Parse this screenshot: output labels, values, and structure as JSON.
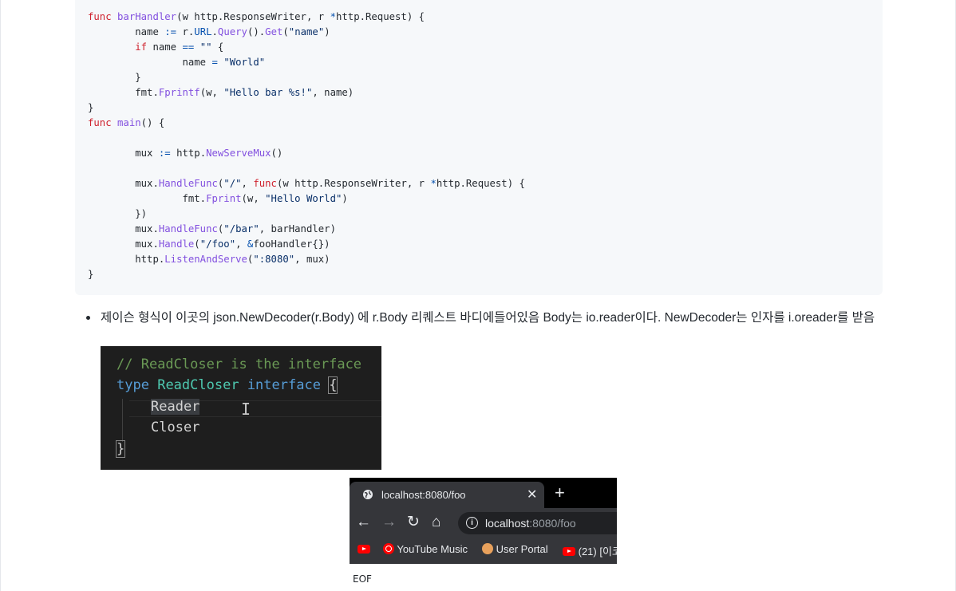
{
  "code_lines": [
    [
      [
        "kw",
        "func"
      ],
      [
        "p",
        " "
      ],
      [
        "fn",
        "barHandler"
      ],
      [
        "p",
        "(w http.ResponseWriter, r "
      ],
      [
        "bl",
        "*"
      ],
      [
        "p",
        "http.Request) {"
      ]
    ],
    [
      [
        "p",
        "\tname "
      ],
      [
        "bl",
        ":="
      ],
      [
        "p",
        " r."
      ],
      [
        "bl",
        "URL"
      ],
      [
        "p",
        "."
      ],
      [
        "fn",
        "Query"
      ],
      [
        "p",
        "()."
      ],
      [
        "fn",
        "Get"
      ],
      [
        "p",
        "("
      ],
      [
        "st",
        "\"name\""
      ],
      [
        "p",
        ")"
      ]
    ],
    [
      [
        "p",
        "\t"
      ],
      [
        "kw",
        "if"
      ],
      [
        "p",
        " name "
      ],
      [
        "bl",
        "=="
      ],
      [
        "p",
        " "
      ],
      [
        "st",
        "\"\""
      ],
      [
        "p",
        " {"
      ]
    ],
    [
      [
        "p",
        "\t\tname "
      ],
      [
        "bl",
        "="
      ],
      [
        "p",
        " "
      ],
      [
        "st",
        "\"World\""
      ]
    ],
    [
      [
        "p",
        "\t}"
      ]
    ],
    [
      [
        "p",
        "\tfmt."
      ],
      [
        "fn",
        "Fprintf"
      ],
      [
        "p",
        "(w, "
      ],
      [
        "st",
        "\"Hello bar %s!\""
      ],
      [
        "p",
        ", name)"
      ]
    ],
    [
      [
        "p",
        "}"
      ]
    ],
    [
      [
        "kw",
        "func"
      ],
      [
        "p",
        " "
      ],
      [
        "fn",
        "main"
      ],
      [
        "p",
        "() {"
      ]
    ],
    [
      [
        "p",
        ""
      ]
    ],
    [
      [
        "p",
        "\tmux "
      ],
      [
        "bl",
        ":="
      ],
      [
        "p",
        " http."
      ],
      [
        "fn",
        "NewServeMux"
      ],
      [
        "p",
        "()"
      ]
    ],
    [
      [
        "p",
        ""
      ]
    ],
    [
      [
        "p",
        "\tmux."
      ],
      [
        "fn",
        "HandleFunc"
      ],
      [
        "p",
        "("
      ],
      [
        "st",
        "\"/\""
      ],
      [
        "p",
        ", "
      ],
      [
        "kw",
        "func"
      ],
      [
        "p",
        "(w http.ResponseWriter, r "
      ],
      [
        "bl",
        "*"
      ],
      [
        "p",
        "http.Request) {"
      ]
    ],
    [
      [
        "p",
        "\t\tfmt."
      ],
      [
        "fn",
        "Fprint"
      ],
      [
        "p",
        "(w, "
      ],
      [
        "st",
        "\"Hello World\""
      ],
      [
        "p",
        ")"
      ]
    ],
    [
      [
        "p",
        "\t})"
      ]
    ],
    [
      [
        "p",
        "\tmux."
      ],
      [
        "fn",
        "HandleFunc"
      ],
      [
        "p",
        "("
      ],
      [
        "st",
        "\"/bar\""
      ],
      [
        "p",
        ", barHandler)"
      ]
    ],
    [
      [
        "p",
        "\tmux."
      ],
      [
        "fn",
        "Handle"
      ],
      [
        "p",
        "("
      ],
      [
        "st",
        "\"/foo\""
      ],
      [
        "p",
        ", "
      ],
      [
        "bl",
        "&"
      ],
      [
        "p",
        "fooHandler{})"
      ]
    ],
    [
      [
        "p",
        "\thttp."
      ],
      [
        "fn",
        "ListenAndServe"
      ],
      [
        "p",
        "("
      ],
      [
        "st",
        "\":8080\""
      ],
      [
        "p",
        ", mux)"
      ]
    ],
    [
      [
        "p",
        "}"
      ]
    ]
  ],
  "bullet": {
    "text": "제이슨 형식이 이곳의 json.NewDecoder(r.Body) 에 r.Body 리퀘스트 바디에들어있음 Body는 io.reader이다. NewDecoder는 인자를 i.oreader를 받음"
  },
  "vscode": {
    "comment": "// ReadCloser is the interface",
    "kw_type": "type",
    "type_name": "ReadCloser",
    "kw_interface": "interface",
    "open_brace": "{",
    "field1": "Reader",
    "field2": "Closer",
    "close_brace": "}",
    "cursor_glyph": "I"
  },
  "browser": {
    "tab_title": "localhost:8080/foo",
    "close_glyph": "✕",
    "new_tab_glyph": "+",
    "back_glyph": "←",
    "forward_glyph": "→",
    "reload_glyph": "↻",
    "home_glyph": "⌂",
    "info_glyph": "i",
    "url_host": "localhost",
    "url_path": ":8080/foo",
    "bookmarks": [
      "YouTube Music",
      "User Portal",
      "(21) [이코"
    ]
  },
  "eof_text": "EOF",
  "colors": {
    "code_bg": "#f6f8fa",
    "keyword": "#cf222e",
    "function": "#8250df",
    "operator": "#0550ae",
    "string": "#0a3069",
    "vscode_bg": "#1e1e1e",
    "browser_bg": "#35363a"
  }
}
